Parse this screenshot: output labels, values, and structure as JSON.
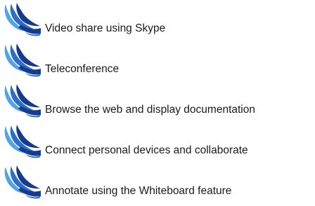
{
  "brand": {
    "icon": "college-wave-logo-icon",
    "colors": {
      "dark_blue": "#163a8c",
      "mid_blue": "#2b6fc7",
      "light_blue": "#4fa3e8"
    }
  },
  "features": [
    {
      "label": "Video share using Skype"
    },
    {
      "label": "Teleconference"
    },
    {
      "label": "Browse the web and display documentation"
    },
    {
      "label": "Connect personal devices and collaborate"
    },
    {
      "label": "Annotate using the Whiteboard feature"
    }
  ]
}
